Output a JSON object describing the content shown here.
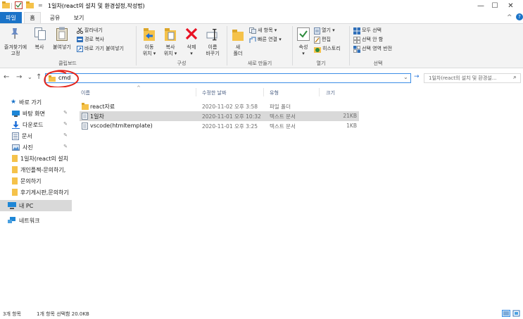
{
  "window": {
    "title": "1일차(react의 설치 및 환경설정,작성법)",
    "quick_access_sep": "=",
    "minimize": "—",
    "maximize": "☐",
    "close": "✕"
  },
  "tabs": [
    {
      "label": "파일"
    },
    {
      "label": "홈"
    },
    {
      "label": "공유"
    },
    {
      "label": "보기"
    }
  ],
  "ribbon": {
    "clipboard": {
      "pin_label_1": "즐겨찾기에",
      "pin_label_2": "고정",
      "copy": "복사",
      "paste": "붙여넣기",
      "cut": "잘라내기",
      "copy_path": "경로 복사",
      "paste_shortcut": "바로 가기 붙여넣기",
      "group": "클립보드"
    },
    "organize": {
      "move_1": "이동",
      "move_2": "위치 ▾",
      "copy_to_1": "복사",
      "copy_to_2": "위치 ▾",
      "delete_1": "삭제",
      "delete_2": "▾",
      "rename_1": "이름",
      "rename_2": "바꾸기",
      "group": "구성"
    },
    "new": {
      "new_folder_1": "새",
      "new_folder_2": "폴더",
      "new_item": "새 항목 ▾",
      "easy_access": "빠른 연결 ▾",
      "group": "새로 만들기"
    },
    "open": {
      "properties_1": "속성",
      "properties_2": "▾",
      "open": "열기 ▾",
      "edit": "편집",
      "history": "히스토리",
      "group": "열기"
    },
    "select": {
      "select_all": "모두 선택",
      "select_none": "선택 안 함",
      "invert": "선택 영역 반전",
      "group": "선택"
    },
    "collapse": "^",
    "help": "?"
  },
  "nav": {
    "back": "←",
    "forward": "→",
    "recent": "⌄",
    "up": "↑",
    "address_value": "cmd",
    "address_dropdown": "⌄",
    "refresh": "→",
    "search_placeholder": "1일차(react의 설치 및 환경설...",
    "search_icon": "⌕"
  },
  "navpane": {
    "items": [
      {
        "label": "바로 가기"
      },
      {
        "label": "바탕 화면"
      },
      {
        "label": "다운로드"
      },
      {
        "label": "문서"
      },
      {
        "label": "사진"
      },
      {
        "label": "1일차(react의 설치"
      },
      {
        "label": "개인플젝-문의하기,"
      },
      {
        "label": "문의하기"
      },
      {
        "label": "후기게시판,문의하기"
      },
      {
        "label": "내 PC"
      },
      {
        "label": "네트워크"
      }
    ],
    "pin": "✎"
  },
  "columns": {
    "name": "이름",
    "date": "수정한 날짜",
    "type": "유형",
    "size": "크기",
    "sort_indicator": "^"
  },
  "files": [
    {
      "name": "react자료",
      "date": "2020-11-02 오후 3:58",
      "type": "파일 폴더",
      "size": ""
    },
    {
      "name": "1일차",
      "date": "2020-11-01 오후 10:32",
      "type": "텍스트 문서",
      "size": "21KB"
    },
    {
      "name": "vscode(htmltemplate)",
      "date": "2020-11-01 오후 3:25",
      "type": "텍스트 문서",
      "size": "1KB"
    }
  ],
  "status": {
    "count": "3개 항목",
    "selected": "1개 항목 선택함 20.0KB"
  },
  "colors": {
    "accent": "#1a73c8",
    "folder": "#f5c24a",
    "delete": "#e81123",
    "annotation": "#e3241b"
  }
}
